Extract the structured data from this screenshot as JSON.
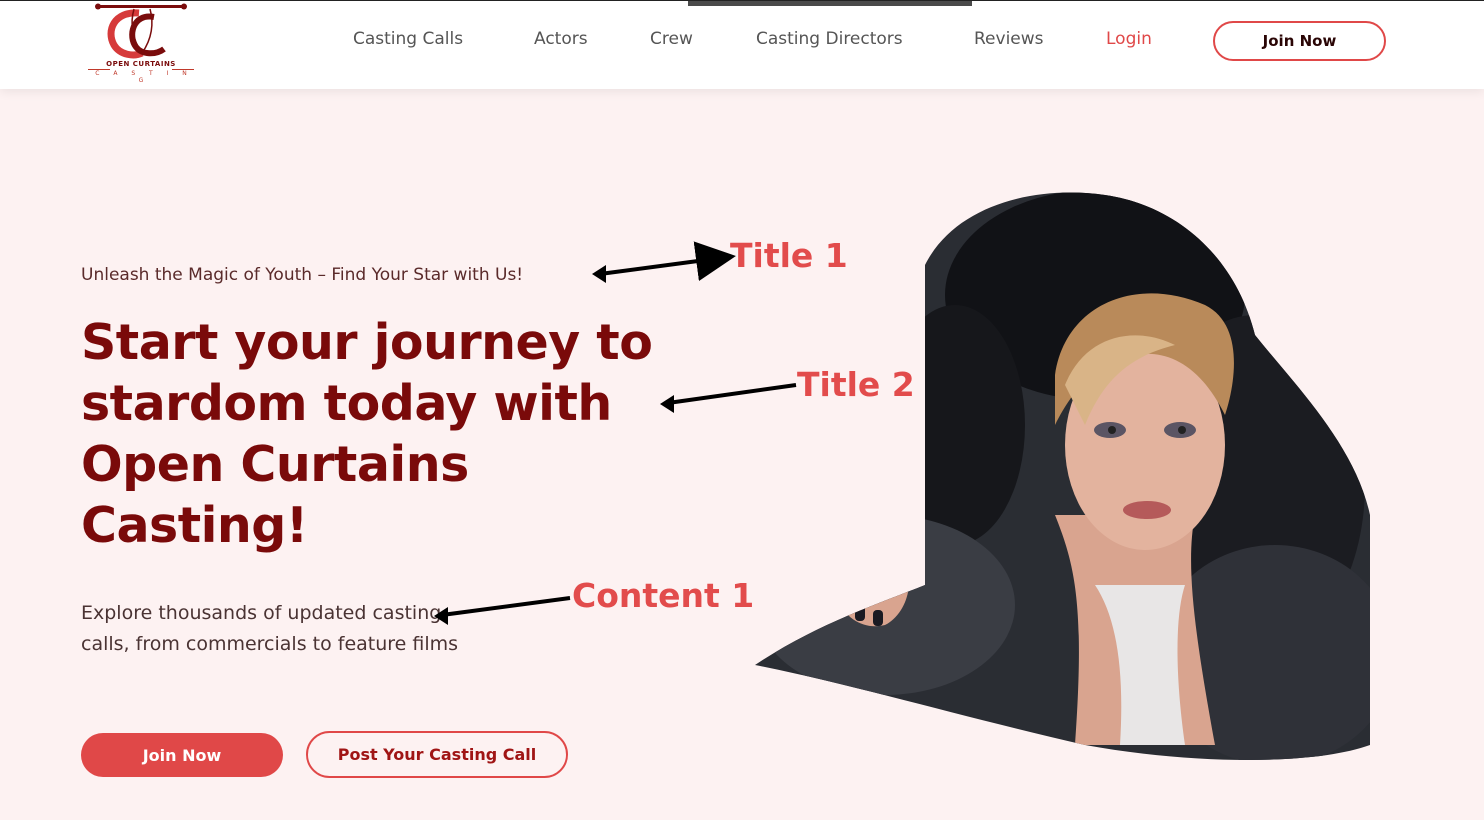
{
  "brand": {
    "logo_name": "OPEN CURTAINS",
    "logo_sub": "C A S T I N G",
    "primary_color": "#e04848",
    "dark_red": "#7a0a0a"
  },
  "nav": {
    "items": [
      {
        "label": "Casting Calls"
      },
      {
        "label": "Actors"
      },
      {
        "label": "Crew"
      },
      {
        "label": "Casting Directors"
      },
      {
        "label": "Reviews"
      },
      {
        "label": "Login"
      }
    ],
    "join_label": "Join Now"
  },
  "hero": {
    "tagline": "Unleash the Magic of Youth – Find Your Star with Us!",
    "headline_lines": [
      "Start your journey to",
      "stardom today with",
      "Open Curtains",
      "Casting!"
    ],
    "content": "Explore thousands of updated casting calls, from commercials to feature films",
    "join_button": "Join Now",
    "post_button": "Post Your Casting Call"
  },
  "annotations": {
    "title1": "Title 1",
    "title2": "Title 2",
    "content1": "Content 1"
  },
  "icons": {
    "logo": "theater-curtains-logo-icon",
    "hero_image": "woman-in-fur-coat-photo"
  }
}
